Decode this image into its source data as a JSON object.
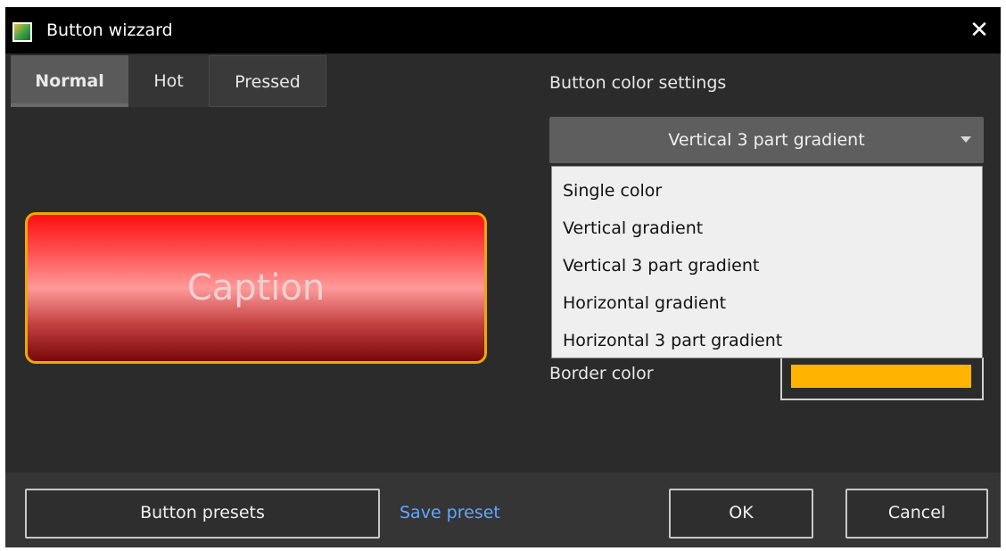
{
  "window": {
    "title": "Button wizzard",
    "close_glyph": "✕"
  },
  "tabs": [
    {
      "label": "Normal",
      "selected": true
    },
    {
      "label": "Hot",
      "selected": false
    },
    {
      "label": "Pressed",
      "selected": false
    }
  ],
  "preview": {
    "caption": "Caption",
    "border_color": "#f0a800"
  },
  "color_settings": {
    "label": "Button color settings",
    "selected": "Vertical 3 part gradient",
    "options": [
      "Single color",
      "Vertical gradient",
      "Vertical 3 part gradient",
      "Horizontal gradient",
      "Horizontal 3 part gradient"
    ]
  },
  "border": {
    "label": "Border color",
    "color": "#ffb400"
  },
  "footer": {
    "presets_label": "Button presets",
    "save_preset_label": "Save preset",
    "ok_label": "OK",
    "cancel_label": "Cancel"
  },
  "icons": {
    "app": "app-icon",
    "close": "close-icon",
    "dropdown": "chevron-down-icon"
  },
  "colors": {
    "background": "#2b2b2b",
    "titlebar": "#000000",
    "link": "#5fa8ff",
    "dropdown_bg": "#5e5e5e",
    "list_bg": "#efefef"
  }
}
